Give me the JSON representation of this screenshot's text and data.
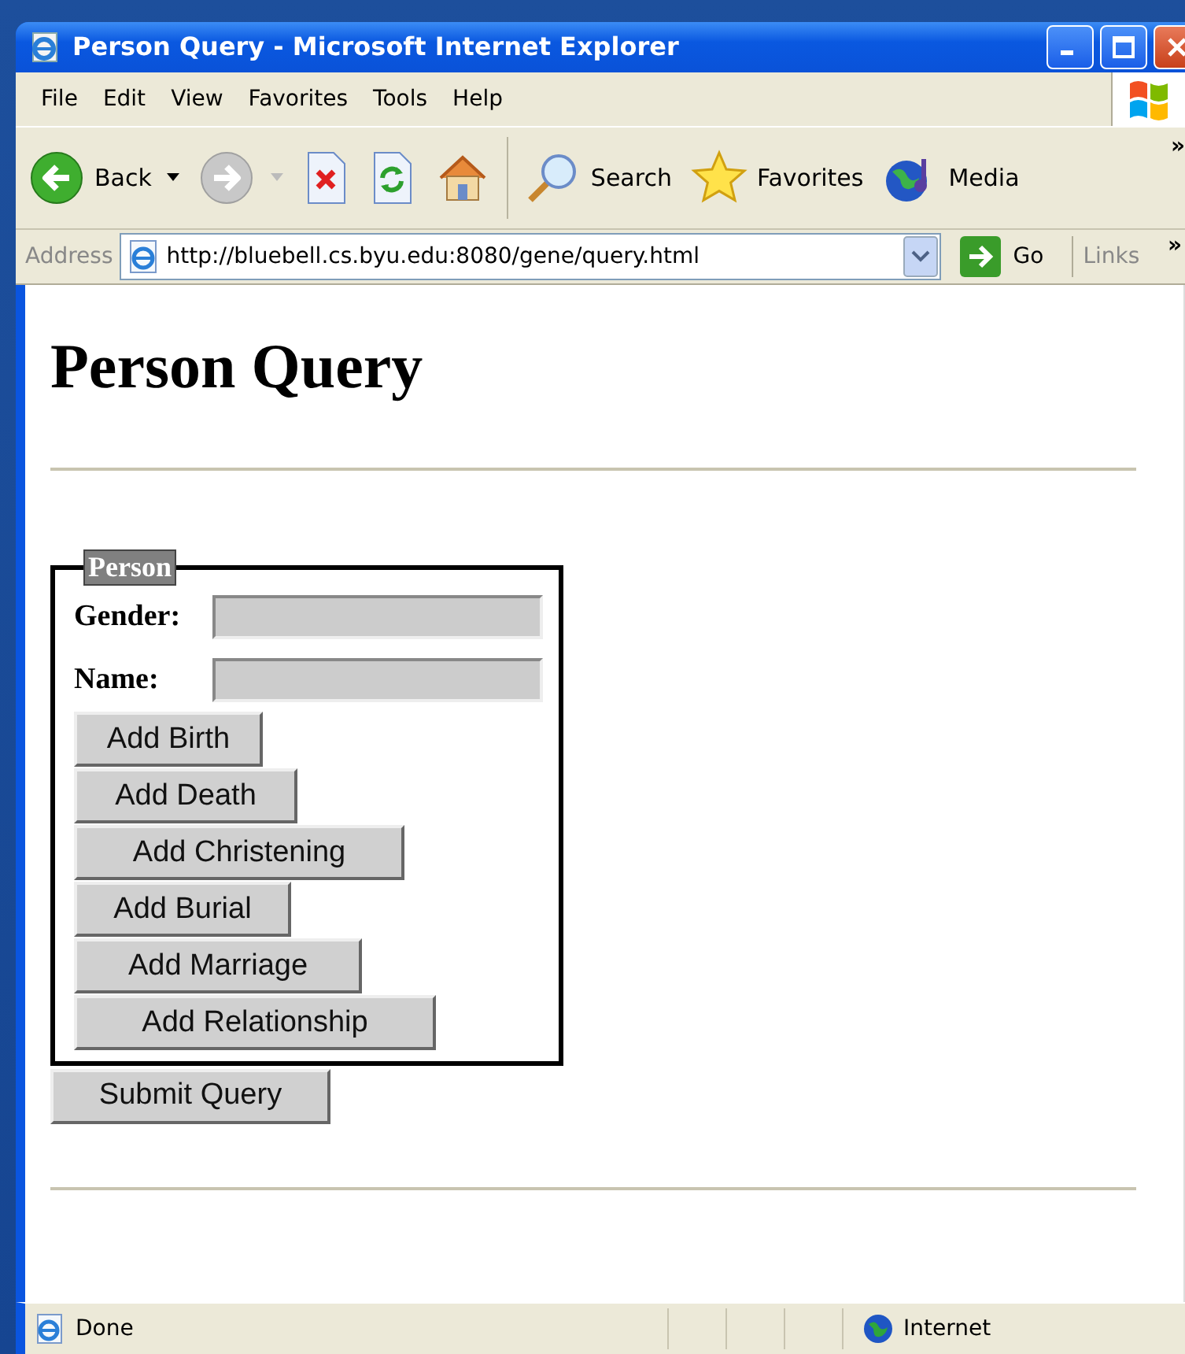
{
  "window": {
    "title": "Person Query - Microsoft Internet Explorer"
  },
  "menu": [
    {
      "label": "File"
    },
    {
      "label": "Edit"
    },
    {
      "label": "View"
    },
    {
      "label": "Favorites"
    },
    {
      "label": "Tools"
    },
    {
      "label": "Help"
    }
  ],
  "toolbar": {
    "items": [
      {
        "kind": "back",
        "label": "Back",
        "disabled": false,
        "dropdown": true
      },
      {
        "kind": "forward",
        "disabled": true,
        "dropdown": true
      },
      {
        "kind": "stop"
      },
      {
        "kind": "refresh"
      },
      {
        "kind": "home"
      },
      {
        "kind": "separator"
      },
      {
        "kind": "search",
        "label": "Search"
      },
      {
        "kind": "favorites",
        "label": "Favorites"
      },
      {
        "kind": "media",
        "label": "Media"
      }
    ],
    "more": "»"
  },
  "address_bar": {
    "label": "Address",
    "value": "http://bluebell.cs.byu.edu:8080/gene/query.html",
    "go": "Go",
    "links": "Links",
    "more": "»"
  },
  "page": {
    "heading": "Person Query",
    "fieldset": {
      "legend": "Person",
      "fields": [
        {
          "label": "Gender:"
        },
        {
          "label": "Name:"
        }
      ],
      "buttons": [
        "Add Birth",
        "Add Death",
        "Add Christening",
        "Add Burial",
        "Add Marriage",
        "Add Relationship"
      ]
    },
    "submit": "Submit Query"
  },
  "status_bar": {
    "text": "Done",
    "zone": "Internet"
  }
}
